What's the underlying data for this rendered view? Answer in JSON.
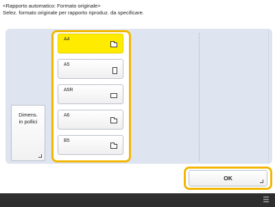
{
  "header": {
    "title": "<Rapporto automatico: Formato originale>",
    "instruction": "Selez. formato originale per rapporto riproduz. da specificare."
  },
  "inches_button": {
    "line1": "Dimens.",
    "line2": "in pollici"
  },
  "sizes": [
    {
      "label": "A4",
      "orientation": "landscape",
      "selected": true
    },
    {
      "label": "A5",
      "orientation": "portrait",
      "selected": false
    },
    {
      "label": "A5R",
      "orientation": "landscape",
      "selected": false
    },
    {
      "label": "A6",
      "orientation": "landscape",
      "selected": false
    },
    {
      "label": "B5",
      "orientation": "landscape",
      "selected": false
    }
  ],
  "ok_button": {
    "label": "OK"
  },
  "colors": {
    "accent": "#f2b600",
    "selected": "#ffeb00",
    "panel": "#dee4f0",
    "bottom_bar": "#2e2e2e"
  },
  "icons": {
    "bottom_bar_icon": "menu-icon"
  }
}
